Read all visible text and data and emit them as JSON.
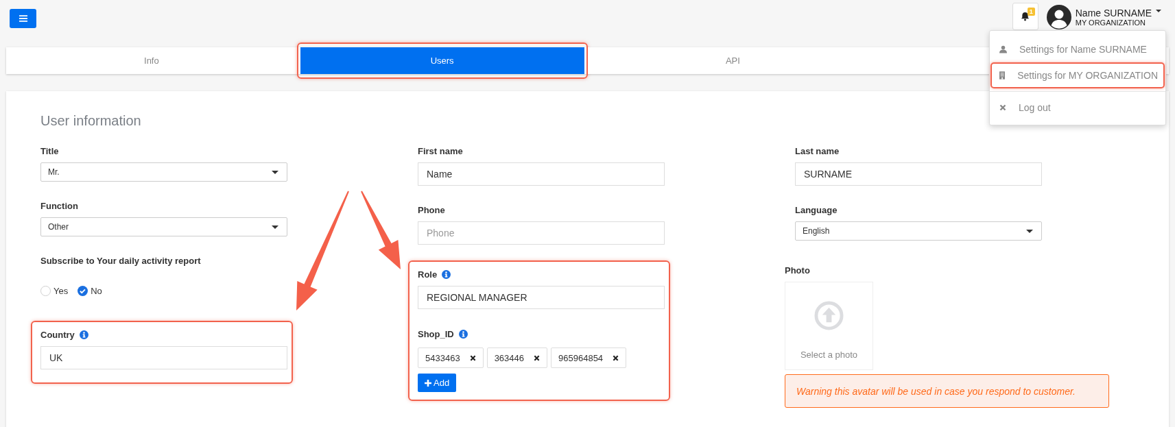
{
  "header": {
    "notification_count": "1",
    "user": {
      "name": "Name SURNAME",
      "organization": "MY ORGANIZATION"
    }
  },
  "user_menu": {
    "items": [
      {
        "kind": "user",
        "label": "Settings for Name SURNAME",
        "highlighted": false
      },
      {
        "kind": "organization",
        "label": "Settings for MY ORGANIZATION",
        "highlighted": true
      },
      {
        "kind": "logout",
        "label": "Log out",
        "highlighted": false
      }
    ]
  },
  "tabs": [
    {
      "label": "Info",
      "selected": false,
      "highlighted": false
    },
    {
      "label": "Users",
      "selected": true,
      "highlighted": true
    },
    {
      "label": "API",
      "selected": false,
      "highlighted": false
    }
  ],
  "form": {
    "title": "User information",
    "columns": [
      [
        {
          "kind": "select",
          "label": "Title",
          "value": "Mr."
        },
        {
          "kind": "select",
          "label": "Function",
          "value": "Other"
        },
        {
          "kind": "radio",
          "label": "Subscribe to Your daily activity report",
          "options": [
            {
              "label": "Yes",
              "selected": false
            },
            {
              "label": "No",
              "selected": true
            }
          ]
        },
        {
          "kind": "group",
          "highlighted": true,
          "fields": [
            {
              "kind": "text",
              "label": "Country",
              "info": true,
              "value": "UK"
            }
          ]
        }
      ],
      [
        {
          "kind": "text",
          "label": "First name",
          "value": "Name"
        },
        {
          "kind": "text",
          "label": "Phone",
          "placeholder": "Phone"
        },
        {
          "kind": "group",
          "highlighted": true,
          "fields": [
            {
              "kind": "text",
              "label": "Role",
              "info": true,
              "value": "REGIONAL MANAGER"
            },
            {
              "kind": "chips",
              "label": "Shop_ID",
              "info": true,
              "chips": [
                "5433463",
                "363446",
                "965964854"
              ],
              "add_label": "Add"
            }
          ]
        }
      ],
      [
        {
          "kind": "text",
          "label": "Last name",
          "value": "SURNAME"
        },
        {
          "kind": "select",
          "label": "Language",
          "value": "English"
        },
        {
          "kind": "photo",
          "label": "Photo",
          "prompt": "Select a photo"
        },
        {
          "kind": "warning",
          "text": "Warning this avatar will be used in case you respond to customer."
        }
      ]
    ]
  }
}
